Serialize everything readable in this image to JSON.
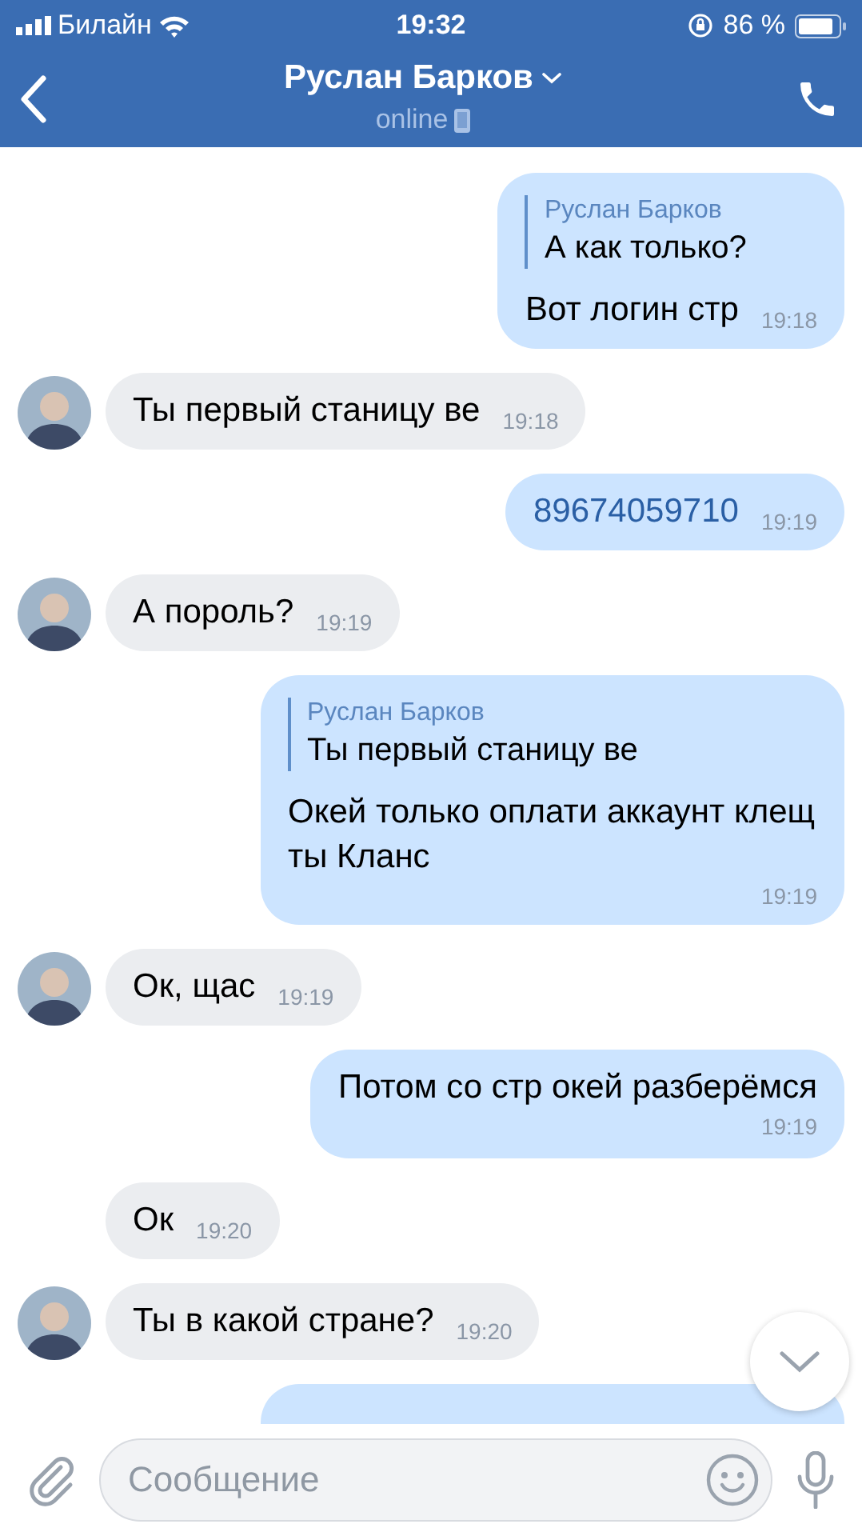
{
  "status_bar": {
    "carrier": "Билайн",
    "time": "19:32",
    "battery": "86 %"
  },
  "header": {
    "title": "Руслан Барков",
    "subtitle": "online"
  },
  "messages": [
    {
      "kind": "out",
      "reply": {
        "author": "Руслан Барков",
        "text": "А как только?"
      },
      "text": "Вот логин стр",
      "time": "19:18"
    },
    {
      "kind": "in",
      "avatar": true,
      "text": "Ты первый станицу ве",
      "time": "19:18"
    },
    {
      "kind": "out",
      "text": "89674059710",
      "time": "19:19",
      "link": true
    },
    {
      "kind": "in",
      "avatar": true,
      "text": "А пороль?",
      "time": "19:19"
    },
    {
      "kind": "out",
      "reply": {
        "author": "Руслан Барков",
        "text": "Ты первый станицу ве"
      },
      "text": "Окей только оплати аккаунт клещ ты Кланс",
      "time": "19:19"
    },
    {
      "kind": "in",
      "avatar": true,
      "text": "Ок, щас",
      "time": "19:19"
    },
    {
      "kind": "out",
      "text": "Потом со стр окей разберёмся",
      "time": "19:19",
      "time_below": true
    },
    {
      "kind": "in",
      "avatar": false,
      "text": "Ок",
      "time": "19:20"
    },
    {
      "kind": "in",
      "avatar": true,
      "text": "Ты в какой стране?",
      "time": "19:20"
    },
    {
      "kind": "out"
    }
  ],
  "composer": {
    "placeholder": "Сообщение"
  }
}
